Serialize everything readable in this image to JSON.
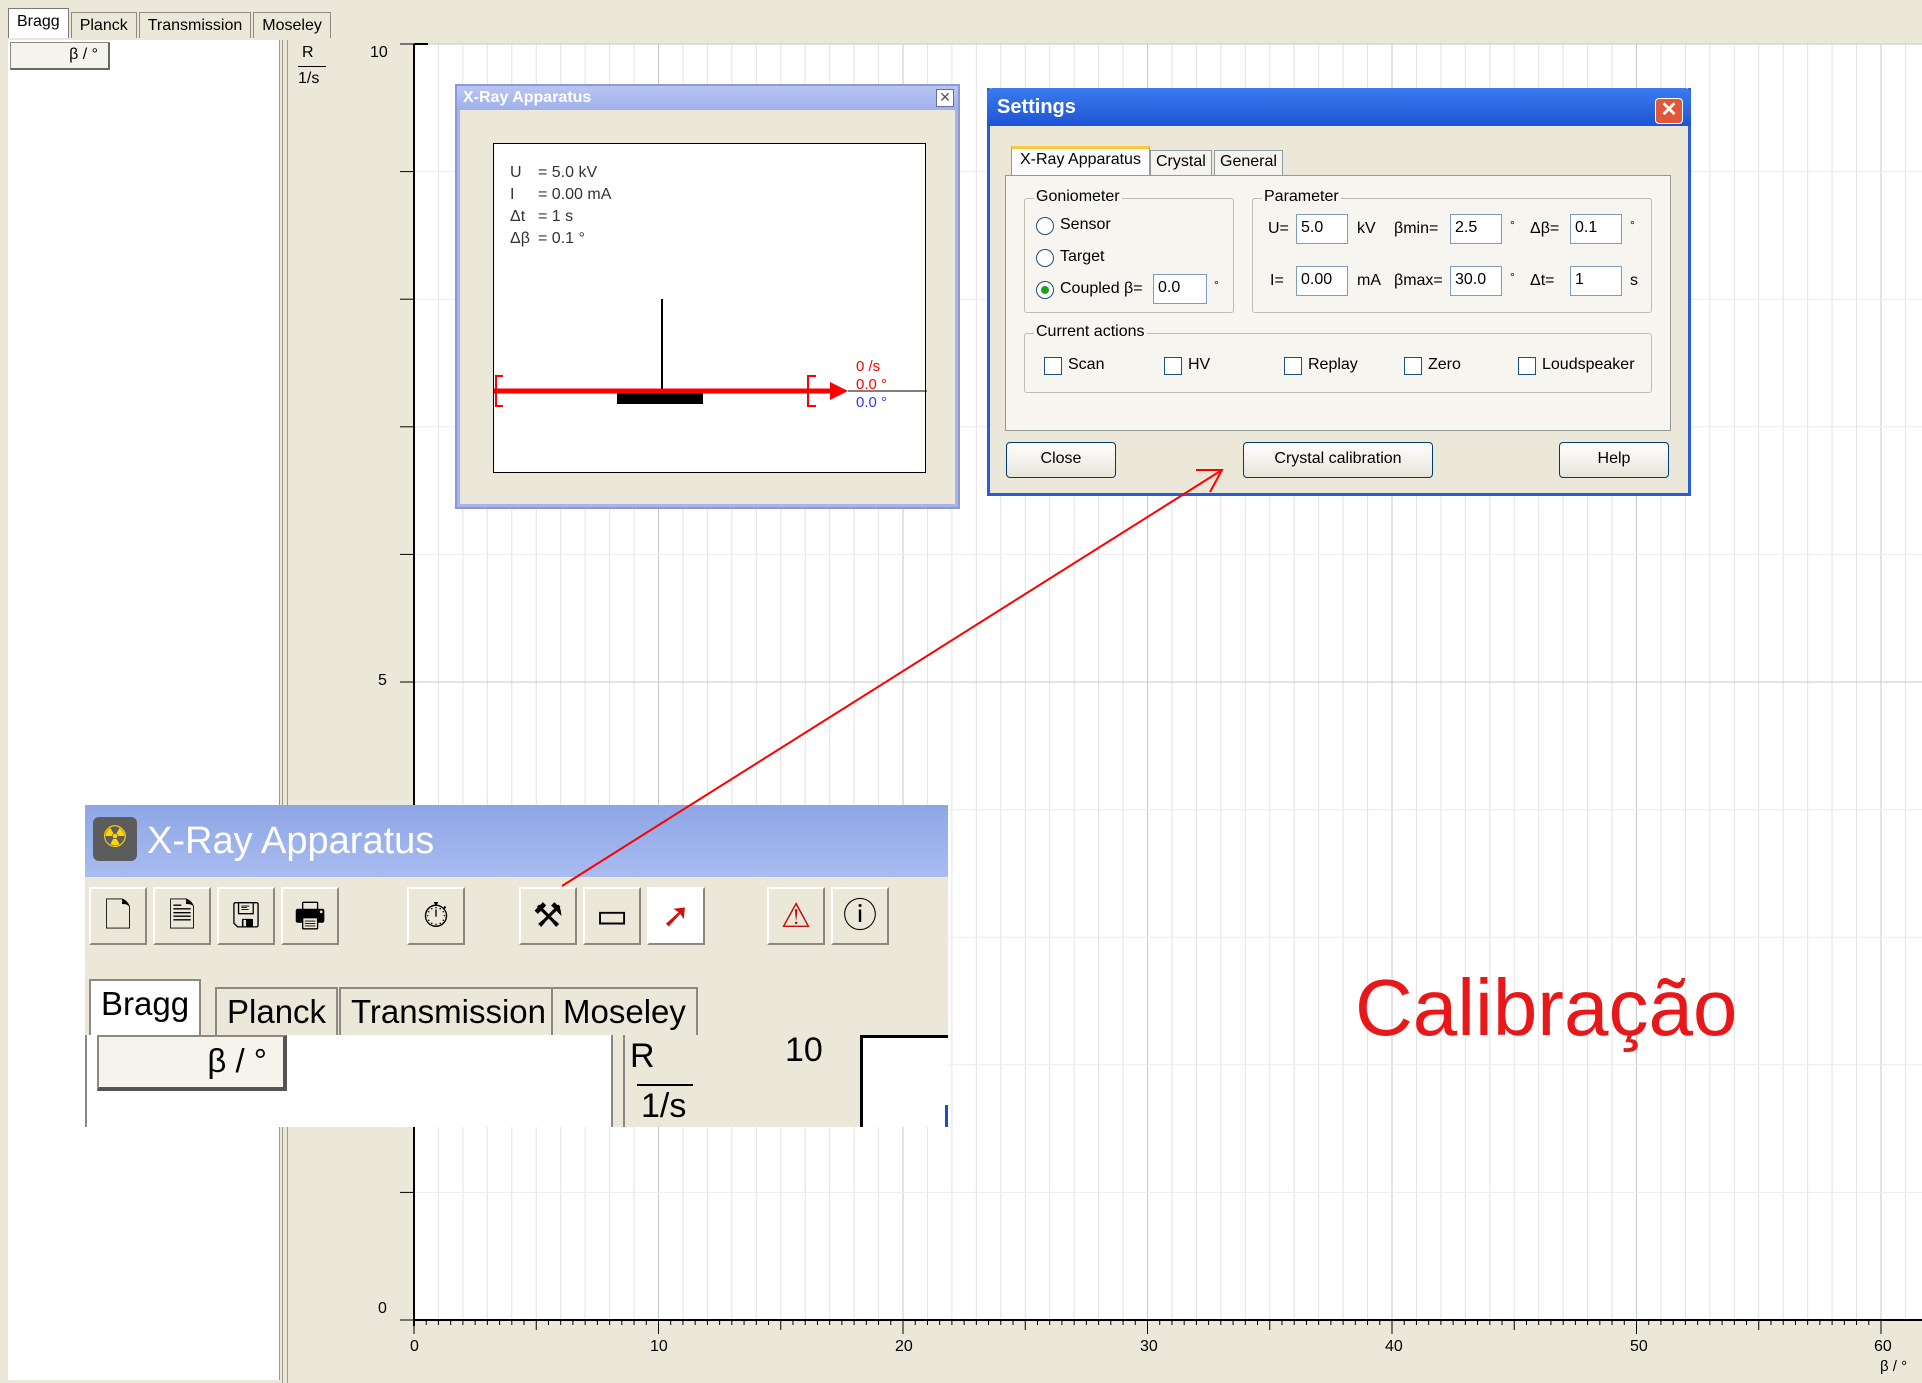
{
  "tabs": [
    "Bragg",
    "Planck",
    "Transmission",
    "Moseley"
  ],
  "table": {
    "beta_header": "β / °"
  },
  "plot": {
    "y_label_top": "R",
    "y_label_unit": "1/s",
    "y_ticks": [
      "10",
      "5",
      "0"
    ],
    "x_ticks": [
      "0",
      "10",
      "20",
      "30",
      "40",
      "50",
      "60"
    ],
    "x_label": "β / °"
  },
  "xray_window": {
    "title": "X-Ray Apparatus",
    "readouts": [
      {
        "name": "U",
        "value": "= 5.0 kV"
      },
      {
        "name": "I",
        "value": "= 0.00 mA"
      },
      {
        "name": "Δt",
        "value": "= 1 s"
      },
      {
        "name": "Δβ",
        "value": "= 0.1 °"
      }
    ],
    "rate": "0 /s",
    "angle_red": "0.0 °",
    "angle_blue": "0.0 °"
  },
  "settings": {
    "title": "Settings",
    "tabs": [
      "X-Ray Apparatus",
      "Crystal",
      "General"
    ],
    "goniometer_label": "Goniometer",
    "goniometer_options": [
      "Sensor",
      "Target",
      "Coupled"
    ],
    "coupled_beta_label": "β=",
    "coupled_beta_value": "0.0",
    "parameter_label": "Parameter",
    "u_label": "U=",
    "u_value": "5.0",
    "u_unit": "kV",
    "beta_min_label": "βmin=",
    "beta_min_value": "2.5",
    "dbeta_label": "Δβ=",
    "dbeta_value": "0.1",
    "i_label": "I=",
    "i_value": "0.00",
    "i_unit": "mA",
    "beta_max_label": "βmax=",
    "beta_max_value": "30.0",
    "dt_label": "Δt=",
    "dt_value": "1",
    "dt_unit": "s",
    "degree": "°",
    "current_actions_label": "Current actions",
    "actions": [
      "Scan",
      "HV",
      "Replay",
      "Zero",
      "Loudspeaker"
    ],
    "close_button": "Close",
    "calibration_button": "Crystal calibration",
    "help_button": "Help"
  },
  "zoom": {
    "title": "X-Ray Apparatus",
    "tabs": [
      "Bragg",
      "Planck",
      "Transmission",
      "Moseley"
    ],
    "beta_header": "β / °",
    "r_label": "R",
    "r_unit": "1/s",
    "r_tick": "10"
  },
  "annotation": "Calibração",
  "colors": {
    "accent_red": "#e8181a",
    "title_blue": "#1d55d4"
  }
}
